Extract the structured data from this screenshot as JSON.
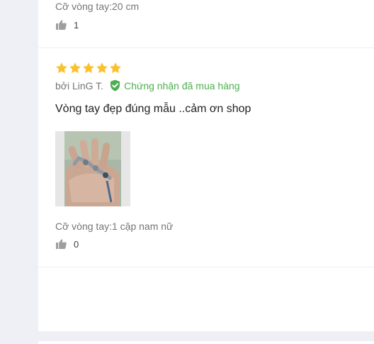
{
  "reviews": [
    {
      "size_text": "Cỡ vòng tay:20 cm",
      "likes": "1"
    },
    {
      "rating": 5,
      "author": "bởi LinG T.",
      "verified_text": "Chứng nhận đã mua hàng",
      "content": "Vòng tay đẹp đúng mẫu ..cảm ơn shop",
      "size_text": "Cỡ vòng tay:1 cặp nam nữ",
      "likes": "0"
    }
  ],
  "icons": {
    "like": "thumbs-up-icon",
    "star": "star-icon",
    "verified": "check-shield-icon"
  },
  "colors": {
    "star": "#fbc02d",
    "verified": "#4caf50",
    "muted": "#757575",
    "text": "#212121",
    "background": "#eff0f5"
  }
}
